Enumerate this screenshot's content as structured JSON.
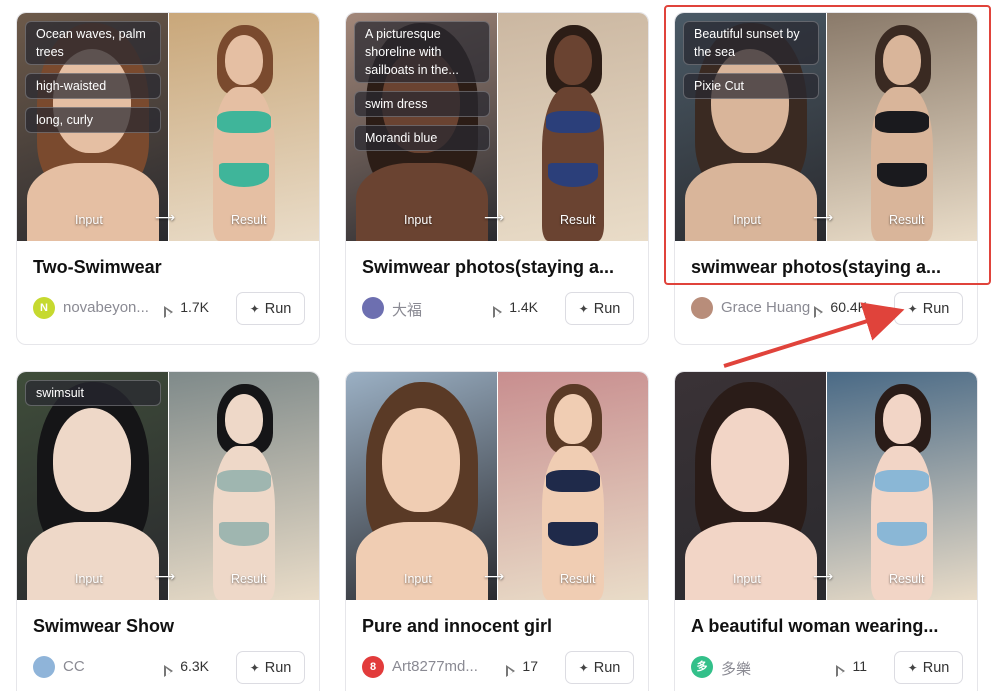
{
  "io": {
    "input_label": "Input",
    "result_label": "Result",
    "arrow": "⟶"
  },
  "run_label": "Run",
  "annotation": {
    "color": "#e0433b"
  },
  "cards": [
    {
      "title": "Two-Swimwear",
      "tags": [
        "Ocean waves, palm trees",
        "high-waisted",
        "long, curly"
      ],
      "author": "novabeyon...",
      "avatar": {
        "text": "N",
        "color": "#c6d92f",
        "icon": "letter-avatar"
      },
      "runs": "1.7K",
      "palette": {
        "left_bg": "#6d5a4a",
        "right_bg": "#c9a77a",
        "skin": "#e5bfa3",
        "hair": "#7a4a2e",
        "swim": "#3fb59a"
      }
    },
    {
      "title": "Swimwear photos(staying a...",
      "tags": [
        "A picturesque shoreline with sailboats in the...",
        "swim dress",
        "Morandi blue"
      ],
      "author": "大福",
      "avatar": {
        "text": "",
        "color": "#6d6fb0",
        "icon": "cartoon-avatar"
      },
      "runs": "1.4K",
      "palette": {
        "left_bg": "#a3887a",
        "right_bg": "#cbb7a1",
        "skin": "#6a4331",
        "hair": "#2c1d16",
        "swim": "#2b3f7a"
      }
    },
    {
      "title": "swimwear photos(staying a...",
      "tags": [
        "Beautiful sunset by the sea",
        "Pixie Cut"
      ],
      "author": "Grace Huang",
      "avatar": {
        "text": "",
        "color": "#b88d7a",
        "icon": "photo-avatar"
      },
      "runs": "60.4K",
      "palette": {
        "left_bg": "#4a5a66",
        "right_bg": "#8a7a6a",
        "skin": "#d9b59a",
        "hair": "#3a2a22",
        "swim": "#1a1a1e"
      }
    },
    {
      "title": "Swimwear Show",
      "tags": [
        "swimsuit"
      ],
      "author": "CC",
      "avatar": {
        "text": "",
        "color": "#8fb4d9",
        "icon": "anime-avatar"
      },
      "runs": "6.3K",
      "palette": {
        "left_bg": "#3f4d3a",
        "right_bg": "#7f8a8a",
        "skin": "#eed8c8",
        "hair": "#151517",
        "swim": "#9fb6b0"
      }
    },
    {
      "title": "Pure and innocent girl",
      "tags": [],
      "author": "Art8277md...",
      "avatar": {
        "text": "8",
        "color": "#e23b3b",
        "icon": "number-avatar"
      },
      "runs": "17",
      "palette": {
        "left_bg": "#9bb0c4",
        "right_bg": "#c88e8f",
        "skin": "#f0cdb3",
        "hair": "#5a3a26",
        "swim": "#1f2a4a"
      }
    },
    {
      "title": "A beautiful woman wearing...",
      "tags": [],
      "author": "多樂",
      "avatar": {
        "text": "多",
        "color": "#33c08a",
        "icon": "text-avatar"
      },
      "runs": "11",
      "palette": {
        "left_bg": "#3a3236",
        "right_bg": "#4a6a86",
        "skin": "#f2d5c6",
        "hair": "#2a1c18",
        "swim": "#8ab7d6"
      }
    }
  ]
}
